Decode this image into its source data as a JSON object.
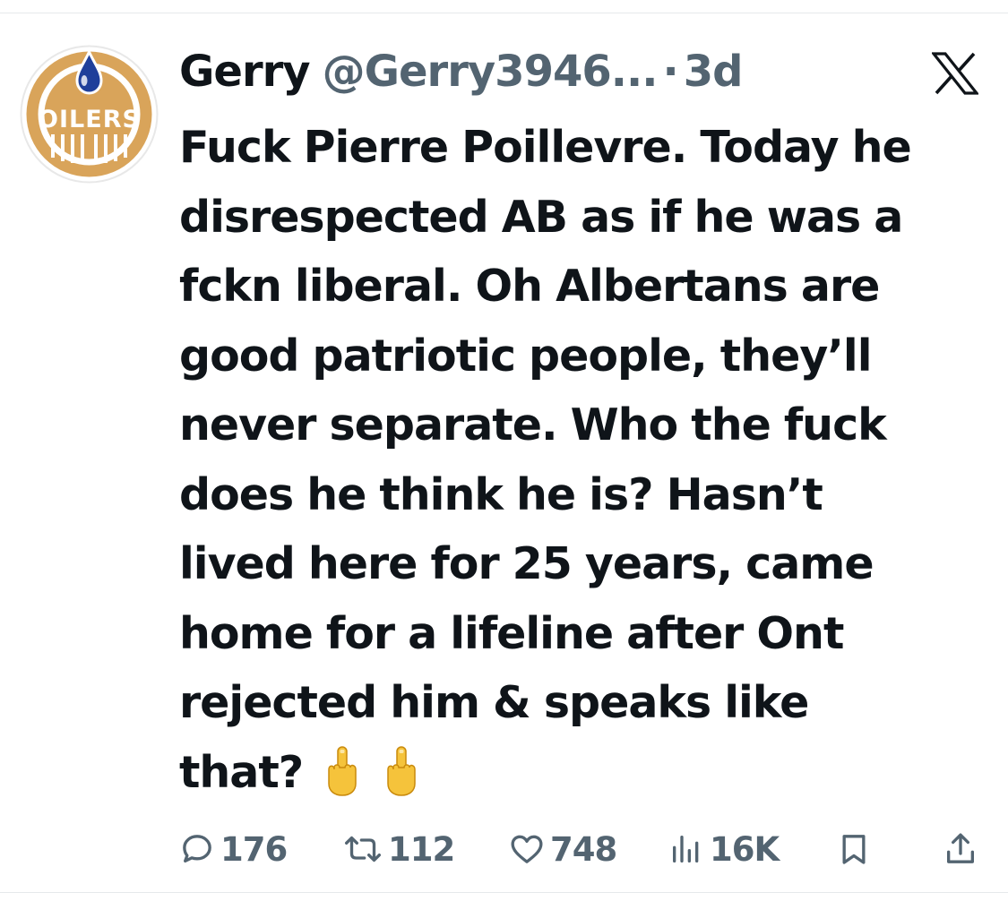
{
  "tweet": {
    "author": {
      "display_name": "Gerry",
      "handle": "@Gerry3946...",
      "avatar_text": "OILERS"
    },
    "separator": "·",
    "timestamp": "3d",
    "platform_icon": "x-logo-icon",
    "text_lines": [
      "Fuck Pierre Poillevre. Today he",
      "disrespected AB as if he was a",
      "fckn liberal. Oh Albertans are",
      "good patriotic people, they’ll",
      "never separate. Who the fuck",
      "does he think he is? Hasn’t",
      "lived here for 25 years, came",
      "home for a lifeline after Ont",
      "rejected him & speaks like",
      "that?"
    ],
    "emojis": [
      "middle-finger-emoji",
      "middle-finger-emoji"
    ],
    "metrics": {
      "replies": "176",
      "retweets": "112",
      "likes": "748",
      "views": "16K"
    }
  },
  "colors": {
    "text_primary": "#0f1419",
    "text_secondary": "#536471",
    "oilers_orange": "#d9a45a",
    "oilers_blue": "#1f3f9a",
    "divider": "#e6e9eb"
  }
}
